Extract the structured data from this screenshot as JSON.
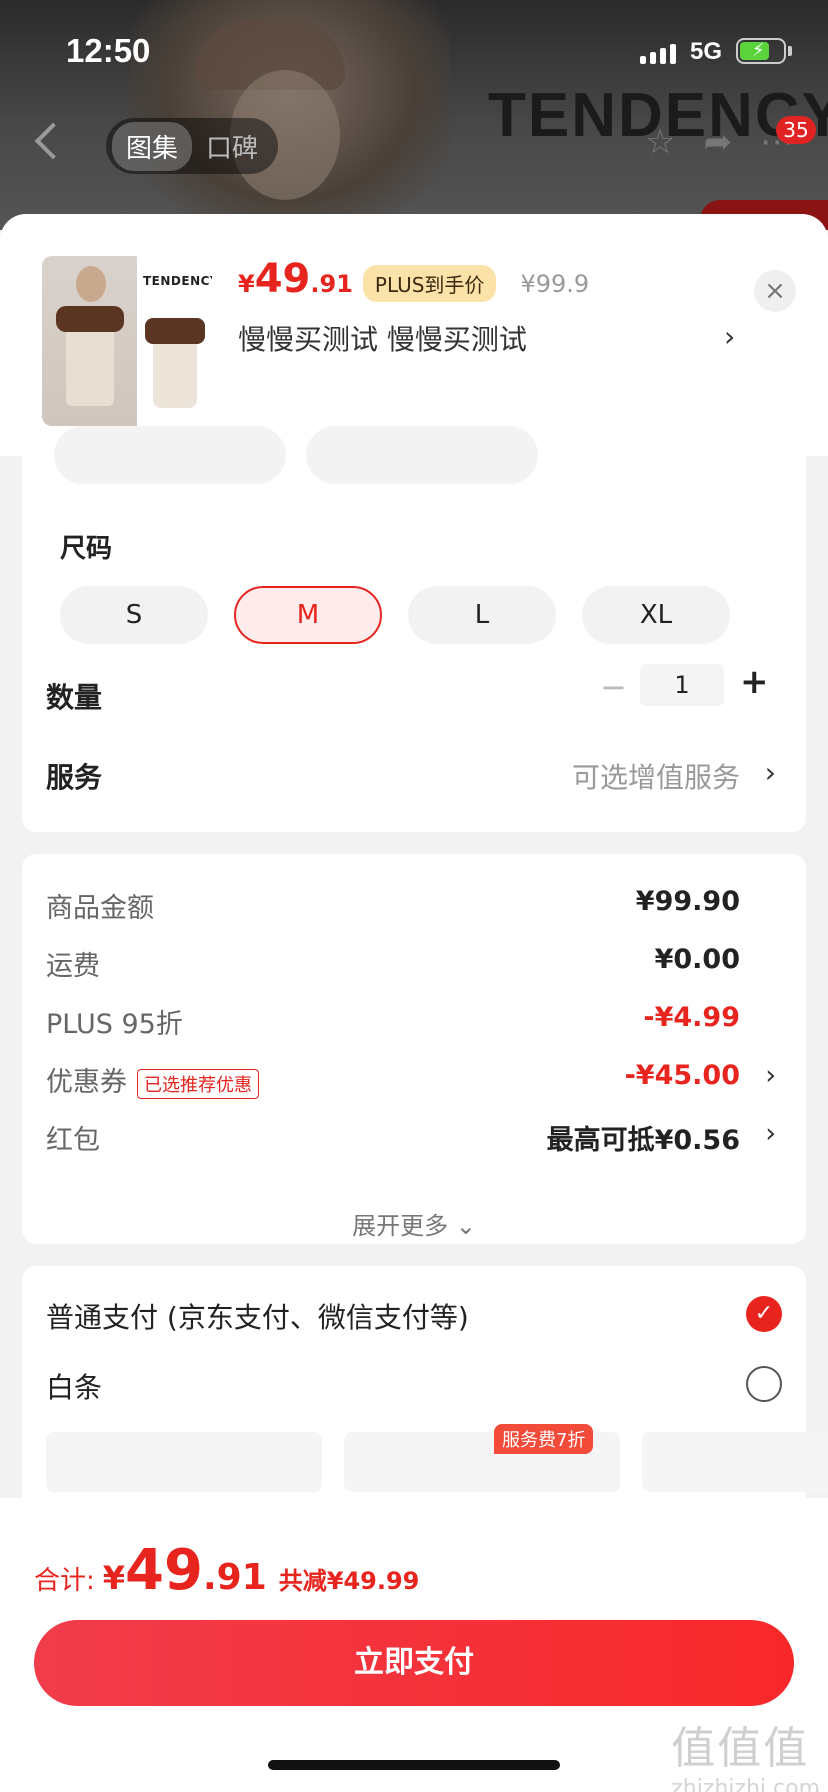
{
  "status_bar": {
    "time": "12:50",
    "network": "5G"
  },
  "backdrop": {
    "brand": "TENDENCY",
    "tabs": [
      {
        "label": "图集",
        "active": true
      },
      {
        "label": "口碑",
        "active": false
      }
    ],
    "cart_badge": "35"
  },
  "product": {
    "thumb_brand": "TENDENCY",
    "price_yen": "¥",
    "price_int": "49",
    "price_dec": ".91",
    "plus_tag": "PLUS到手价",
    "old_price": "¥99.9",
    "sku_text": "慢慢买测试  慢慢买测试",
    "sku_chevron": "›",
    "close_icon": "×"
  },
  "size": {
    "title": "尺码",
    "options": [
      {
        "label": "S",
        "selected": false
      },
      {
        "label": "M",
        "selected": true
      },
      {
        "label": "L",
        "selected": false
      },
      {
        "label": "XL",
        "selected": false
      }
    ]
  },
  "quantity": {
    "label": "数量",
    "minus": "−",
    "value": "1",
    "plus": "+"
  },
  "service": {
    "label": "服务",
    "value": "可选增值服务",
    "chevron": "›"
  },
  "summary": {
    "goods": {
      "label": "商品金额",
      "value": "¥99.90"
    },
    "shipping": {
      "label": "运费",
      "value": "¥0.00"
    },
    "plus": {
      "label": "PLUS 95折",
      "value": "-¥4.99"
    },
    "coupon": {
      "label": "优惠券",
      "tag": "已选推荐优惠",
      "value": "-¥45.00",
      "chevron": "›"
    },
    "redpacket": {
      "label": "红包",
      "value": "最高可抵¥0.56",
      "chevron": "›"
    },
    "expand": "展开更多 ⌄"
  },
  "payment": {
    "options": [
      {
        "label": "普通支付 (京东支付、微信支付等)",
        "selected": true,
        "check": "✓"
      },
      {
        "label": "白条",
        "selected": false
      }
    ],
    "plan_tag": "服务费7折"
  },
  "footer": {
    "total_label": "合计:",
    "total_yen": "¥",
    "total_int": "49",
    "total_dec": ".91",
    "saving": "共减¥49.99",
    "pay_button": "立即支付"
  },
  "watermark": {
    "big": "值值值",
    "small": "zhizhizhi.com"
  },
  "colors": {
    "accent": "#e8241e",
    "plus_tag_bg": "#fbe2a8",
    "button_gradient_start": "#f13c4b",
    "button_gradient_end": "#f8282a"
  }
}
